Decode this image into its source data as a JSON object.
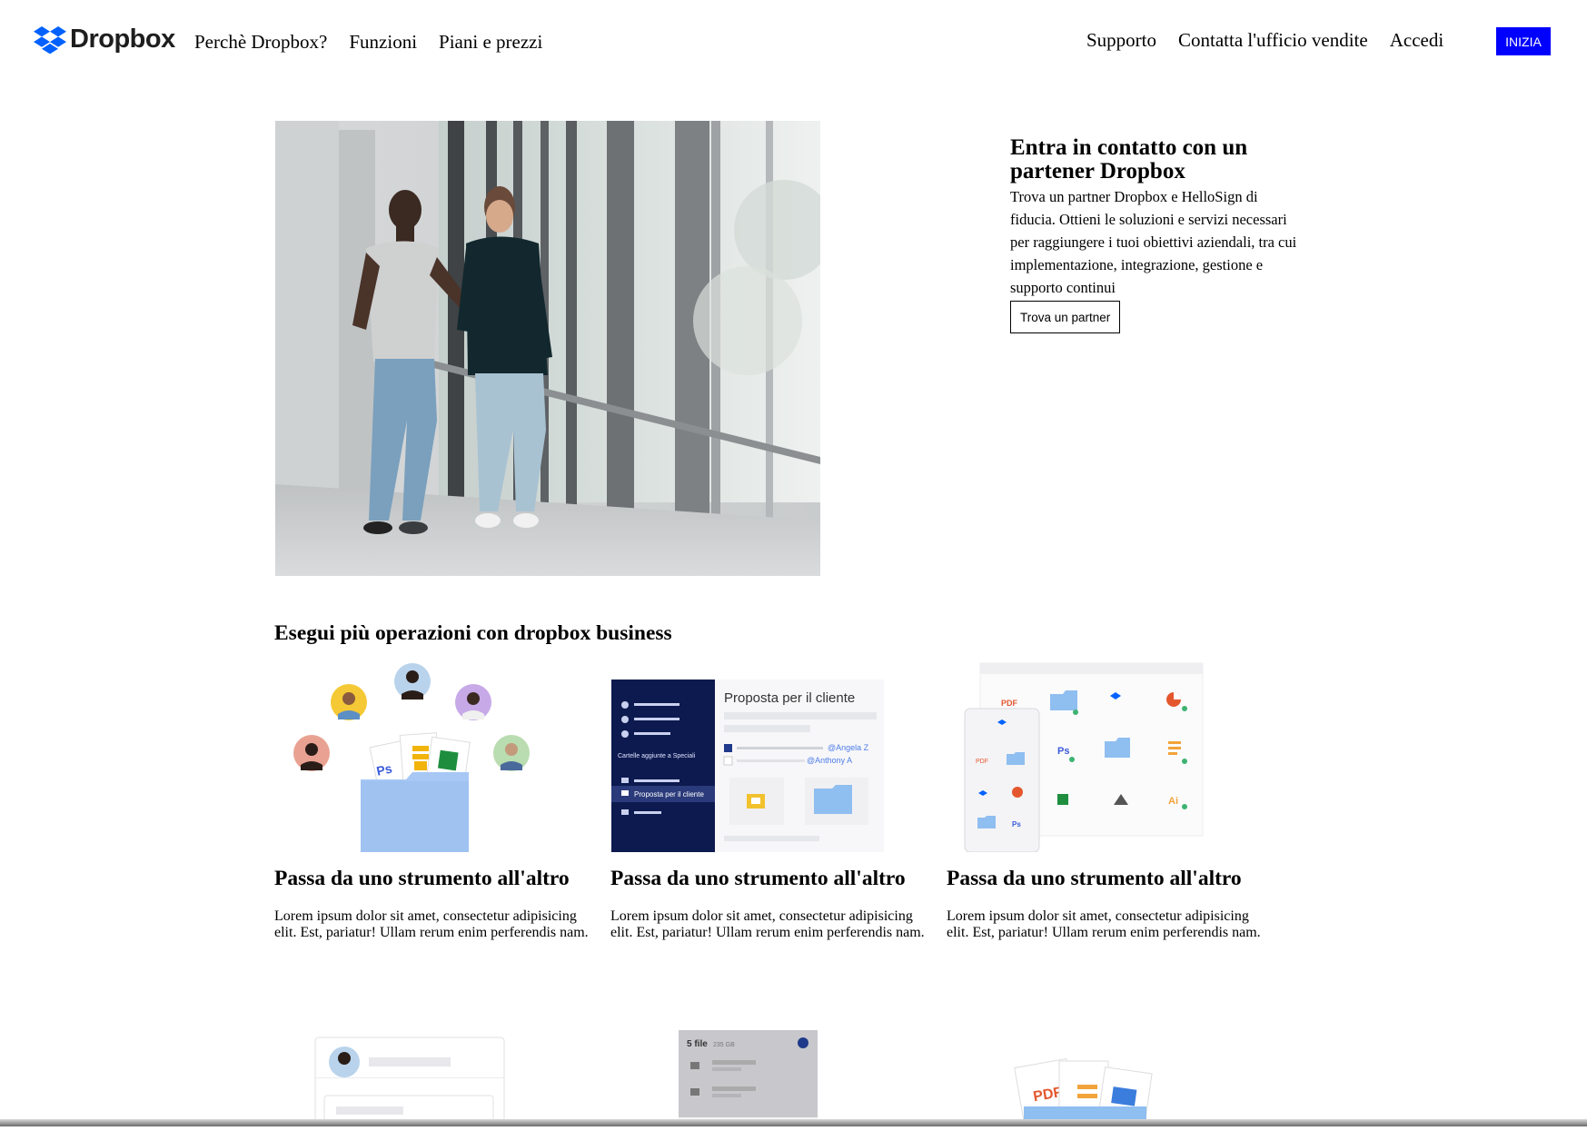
{
  "brand": {
    "name": "Dropbox",
    "logo_icon": "dropbox-box-icon",
    "accent": "#0061ff"
  },
  "nav": {
    "left_links": [
      "Perchè Dropbox?",
      "Funzioni",
      "Piani e prezzi"
    ],
    "right_links": [
      "Supporto",
      "Contatta l'ufficio vendite",
      "Accedi"
    ],
    "cta_label": "INIZIA",
    "cta_color": "#0000ff"
  },
  "hero": {
    "title": "Entra in contatto con un partener Dropbox",
    "description": "Trova un partner Dropbox e HelloSign di fiducia. Ottieni le soluzioni e servizi necessari per raggiungere i tuoi obiettivi aziendali, tra cui implementazione, integrazione, gestione e supporto continui",
    "button_label": "Trova un partner"
  },
  "section": {
    "title": "Esegui più operazioni con dropbox business",
    "cards": [
      {
        "title": "Passa da uno strumento all'altro",
        "description": "Lorem ipsum dolor sit amet, consectetur adipisicing elit. Est, pariatur! Ullam rerum enim perferendis nam."
      },
      {
        "title": "Passa da uno strumento all'altro",
        "description": "Lorem ipsum dolor sit amet, consectetur adipisicing elit. Est, pariatur! Ullam rerum enim perferendis nam."
      },
      {
        "title": "Passa da uno strumento all'altro",
        "description": "Lorem ipsum dolor sit amet, consectetur adipisicing elit. Est, pariatur! Ullam rerum enim perferendis nam."
      }
    ]
  },
  "illustration_texts": {
    "mockup_title": "Proposta per il cliente",
    "mention_1": "@Angela Z",
    "mention_2": "@Anthony A",
    "sidebar_section": "Cartelle aggiunte a Speciali",
    "sidebar_selected": "Proposta per il cliente",
    "file_labels": [
      "PDF",
      "Ps",
      "Ai"
    ],
    "bottom_files_count": "5 file",
    "bottom_files_size": "235 GB",
    "bottom_pdf_label": "PDF"
  }
}
